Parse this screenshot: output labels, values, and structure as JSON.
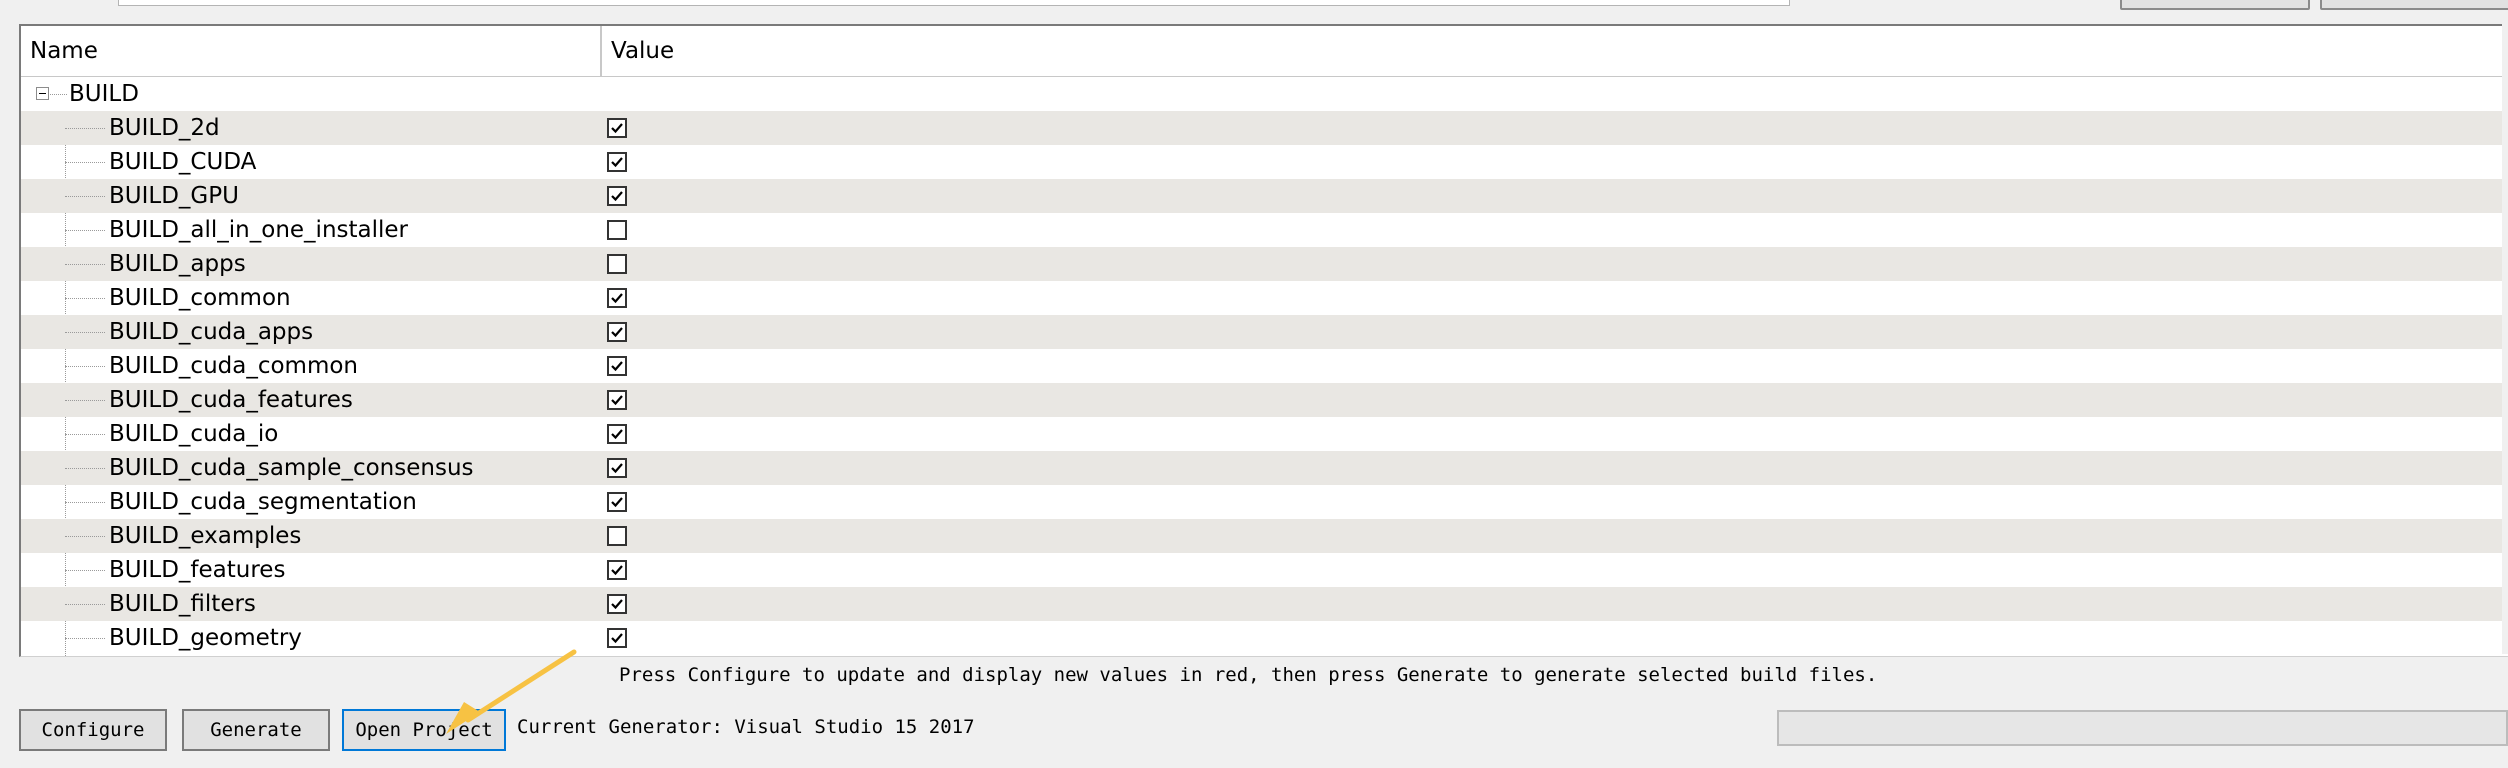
{
  "grid": {
    "columns": {
      "name": "Name",
      "value": "Value"
    },
    "group": {
      "label": "BUILD",
      "expanded": true
    },
    "rows": [
      {
        "name": "BUILD_2d",
        "checked": true
      },
      {
        "name": "BUILD_CUDA",
        "checked": true
      },
      {
        "name": "BUILD_GPU",
        "checked": true
      },
      {
        "name": "BUILD_all_in_one_installer",
        "checked": false
      },
      {
        "name": "BUILD_apps",
        "checked": false
      },
      {
        "name": "BUILD_common",
        "checked": true
      },
      {
        "name": "BUILD_cuda_apps",
        "checked": true
      },
      {
        "name": "BUILD_cuda_common",
        "checked": true
      },
      {
        "name": "BUILD_cuda_features",
        "checked": true
      },
      {
        "name": "BUILD_cuda_io",
        "checked": true
      },
      {
        "name": "BUILD_cuda_sample_consensus",
        "checked": true
      },
      {
        "name": "BUILD_cuda_segmentation",
        "checked": true
      },
      {
        "name": "BUILD_examples",
        "checked": false
      },
      {
        "name": "BUILD_features",
        "checked": true
      },
      {
        "name": "BUILD_filters",
        "checked": true
      },
      {
        "name": "BUILD_geometry",
        "checked": true
      }
    ]
  },
  "status": {
    "hint": "Press Configure to update and display new values in red, then press Generate to generate selected build files.",
    "generator": "Current Generator: Visual Studio 15 2017"
  },
  "buttons": {
    "configure": "Configure",
    "generate": "Generate",
    "open_project": "Open Project"
  },
  "colors": {
    "row_alt": "#e9e7e3",
    "annotation_arrow": "#f7c243",
    "focus_border": "#0078d7"
  },
  "icons": {
    "checkbox": "checkmark-icon",
    "tree_toggle": "collapse-minus-icon",
    "annotation": "arrow-annotation-icon"
  }
}
